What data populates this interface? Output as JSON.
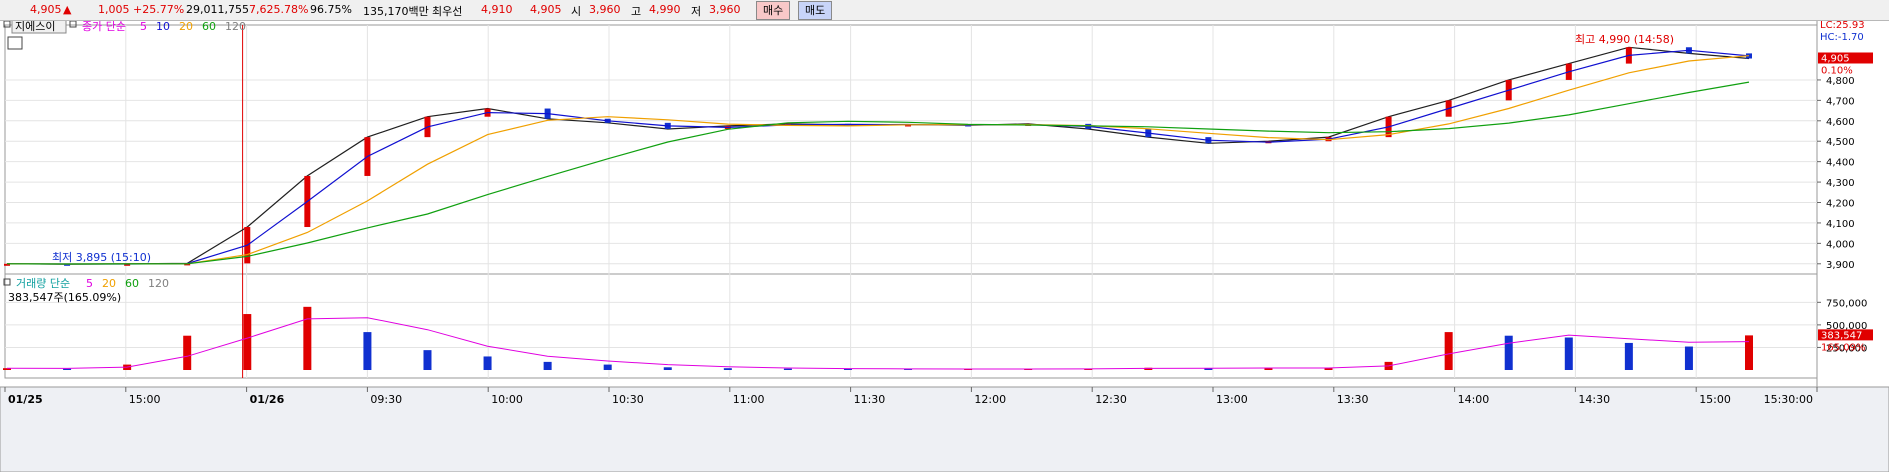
{
  "quote": {
    "price": "4,905",
    "up_arrow": "▲",
    "change": "1,005",
    "change_pct": "+25.77%",
    "volume": "29,011,755",
    "volume_ratio": "7,625.78%",
    "exec_strength": "96.75%",
    "amount": "135,170백만",
    "best_label": "최우선",
    "best_ask": "4,910",
    "best_bid": "4,905",
    "open_label": "시",
    "open": "3,960",
    "high_label": "고",
    "high": "4,990",
    "low_label": "저",
    "low": "3,960"
  },
  "buttons": {
    "buy": "매수",
    "sell": "매도"
  },
  "price_panel": {
    "tab": "지에스이",
    "ma_label": "종가 단순",
    "ma": [
      "5",
      "10",
      "20",
      "60",
      "120"
    ],
    "ma_colors": [
      "#e000e0",
      "#1010d0",
      "#f0a000",
      "#10a010",
      "#808080"
    ],
    "lc": "LC:25.93",
    "hc": "HC:-1.70",
    "current_price_tag": "4,905",
    "current_pct_tag": "0.10%",
    "high_annotation": "최고 4,990 (14:58)",
    "low_annotation": "최저 3,895 (15:10)"
  },
  "volume_panel": {
    "label": "거래량 단순",
    "ma": [
      "5",
      "20",
      "60",
      "120"
    ],
    "value_text": "383,547주(165.09%)",
    "volume_tag": "383,547",
    "volume_pct_tag": "165.09%"
  },
  "colors": {
    "up": "#e00000",
    "down": "#1030d0",
    "tag_bg": "#e00000"
  },
  "chart_data": [
    {
      "type": "line",
      "name": "price",
      "y_ticks": [
        "4,800",
        "4,700",
        "4,600",
        "4,500",
        "4,400",
        "4,300",
        "4,200",
        "4,100",
        "4,000",
        "3,900"
      ],
      "ylim": [
        3850,
        5020
      ],
      "x_ticks": [
        "01/25",
        "15:00",
        "01/26",
        "09:30",
        "10:00",
        "10:30",
        "11:00",
        "11:30",
        "12:00",
        "12:30",
        "13:00",
        "13:30",
        "14:00",
        "14:30",
        "15:00",
        "15:30:00"
      ],
      "series": [
        {
          "values": [
            3900,
            3898,
            3900,
            3902,
            4080,
            4330,
            4520,
            4620,
            4660,
            4610,
            4590,
            4560,
            4575,
            4585,
            4580,
            4582,
            4578,
            4585,
            4560,
            4520,
            4490,
            4500,
            4520,
            4620,
            4700,
            4800,
            4880,
            4960,
            4930,
            4905
          ]
        }
      ]
    },
    {
      "type": "bar",
      "name": "volume",
      "y_ticks": [
        "750,000",
        "500,000",
        "250,000"
      ],
      "ylim": [
        0,
        820000
      ],
      "values": [
        20000,
        15000,
        60000,
        380000,
        620000,
        700000,
        420000,
        220000,
        150000,
        90000,
        60000,
        30000,
        20000,
        15000,
        12000,
        10000,
        10000,
        12000,
        15000,
        25000,
        20000,
        22000,
        25000,
        90000,
        420000,
        380000,
        360000,
        300000,
        260000,
        383547
      ]
    }
  ]
}
